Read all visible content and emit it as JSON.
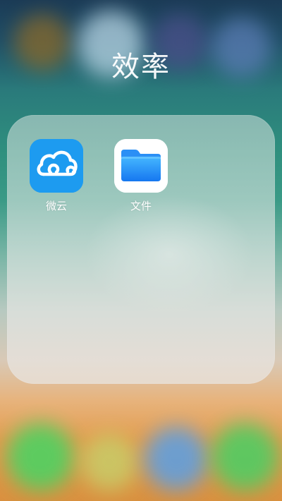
{
  "folder": {
    "title": "效率"
  },
  "apps": [
    {
      "label": "微云",
      "icon": "weiyun-cloud-icon",
      "color": "#1D9BF0"
    },
    {
      "label": "文件",
      "icon": "files-folder-icon",
      "color": "#1E8CF5"
    }
  ],
  "colors": {
    "panel": "#E8ECEA",
    "label_text": "#FFFFFF"
  }
}
